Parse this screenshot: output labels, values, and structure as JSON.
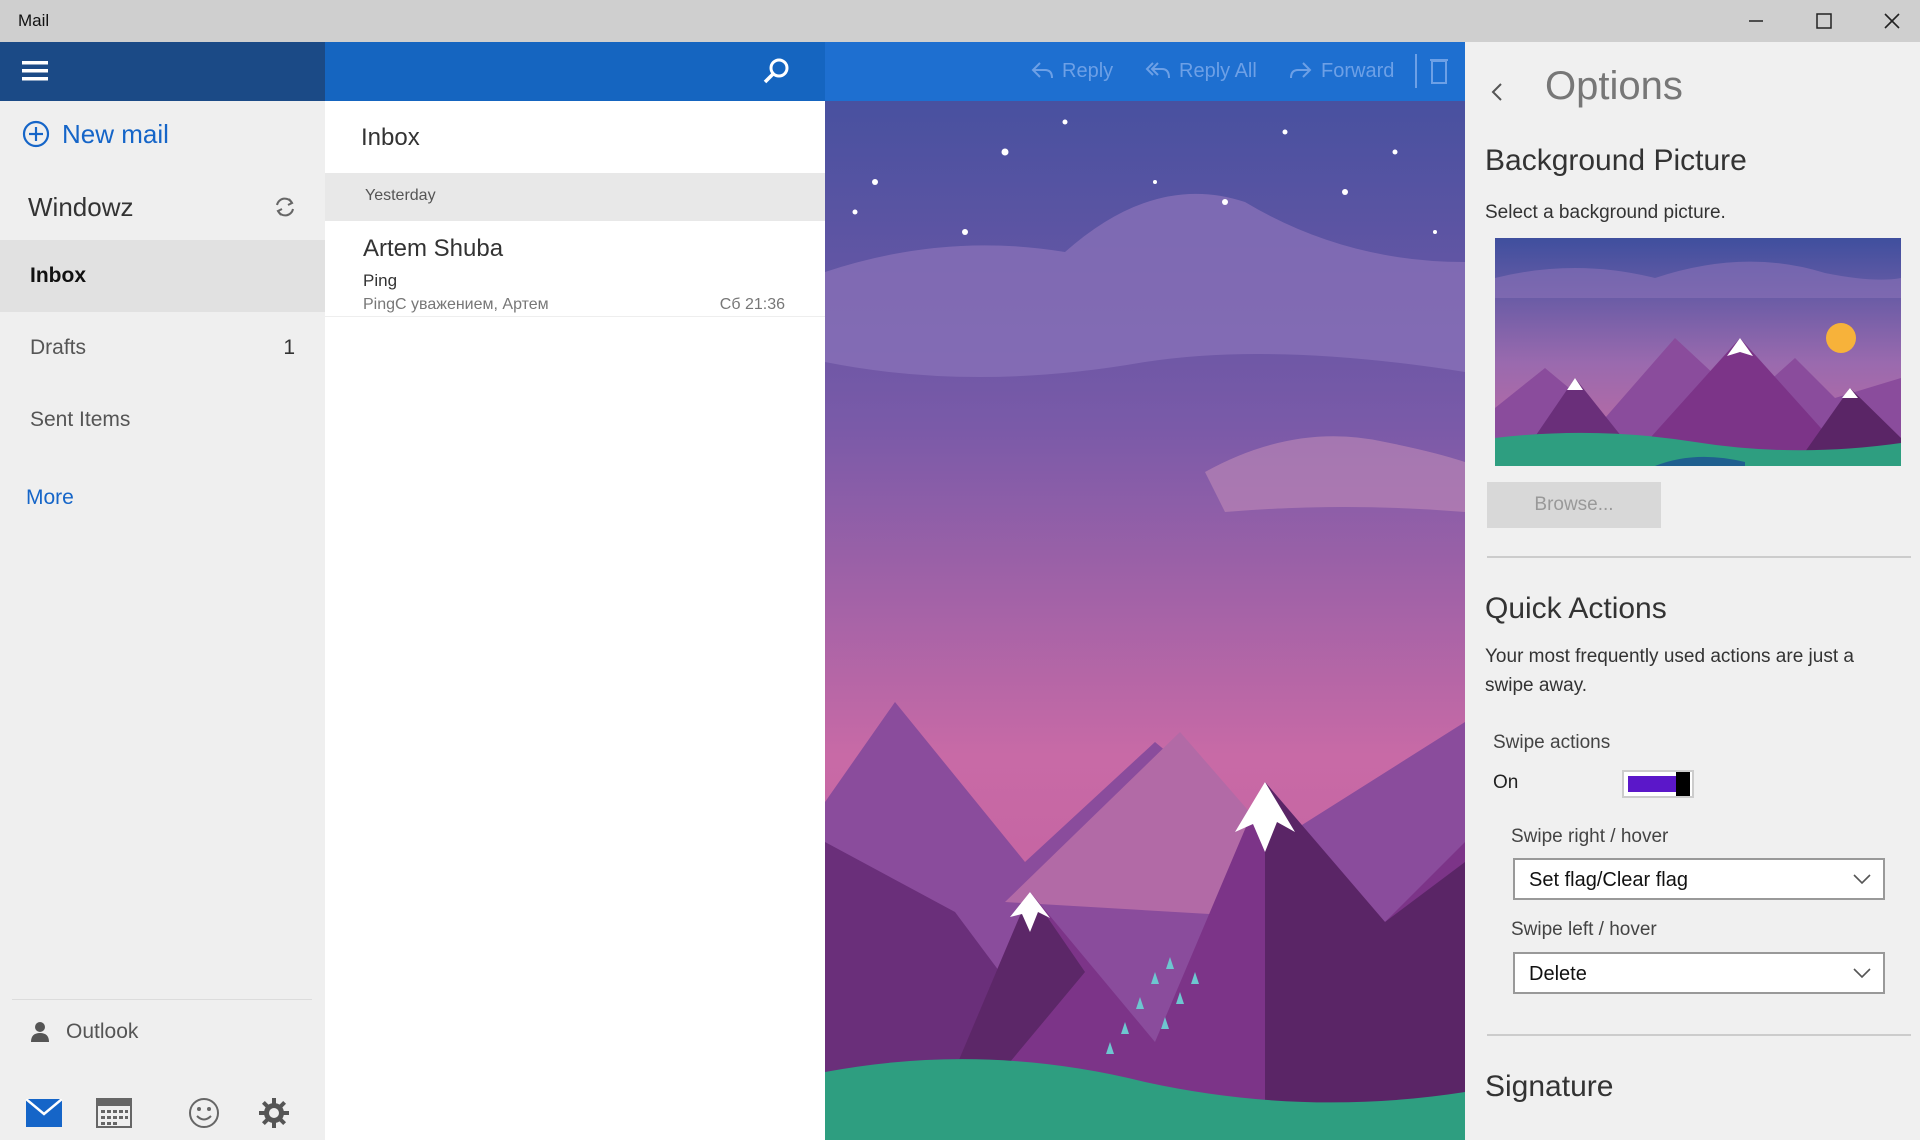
{
  "window": {
    "title": "Mail",
    "controls": [
      "minimize-icon",
      "maximize-icon",
      "close-icon"
    ]
  },
  "nav": {
    "new_mail": "New mail",
    "account_name": "Windowz",
    "folders": [
      {
        "label": "Inbox",
        "count": "",
        "selected": true
      },
      {
        "label": "Drafts",
        "count": "1",
        "selected": false
      },
      {
        "label": "Sent Items",
        "count": "",
        "selected": false
      }
    ],
    "more": "More",
    "account": "Outlook",
    "bottom_icons": [
      "mail-icon",
      "calendar-icon",
      "feedback-smiley-icon",
      "settings-gear-icon"
    ]
  },
  "message_list": {
    "title": "Inbox",
    "date_group": "Yesterday",
    "messages": [
      {
        "sender": "Artem Shuba",
        "subject": "Ping",
        "preview": "PingС уважением, Артем",
        "time": "Сб 21:36"
      }
    ]
  },
  "reading_pane": {
    "commands": [
      {
        "label": "Reply",
        "icon": "reply-icon"
      },
      {
        "label": "Reply All",
        "icon": "reply-all-icon"
      },
      {
        "label": "Forward",
        "icon": "forward-icon"
      }
    ],
    "background": "mountain night landscape"
  },
  "options": {
    "title": "Options",
    "background_picture": {
      "title": "Background Picture",
      "description": "Select a background picture.",
      "browse": "Browse..."
    },
    "quick_actions": {
      "title": "Quick Actions",
      "description": "Your most frequently used actions are just a swipe away.",
      "swipe_actions_label": "Swipe actions",
      "swipe_actions_state": "On",
      "swipe_right_label": "Swipe right / hover",
      "swipe_right_value": "Set flag/Clear flag",
      "swipe_left_label": "Swipe left / hover",
      "swipe_left_value": "Delete"
    },
    "signature": {
      "title": "Signature"
    }
  },
  "colors": {
    "nav_header": "#1b4a86",
    "list_header": "#1565c0",
    "command_bar": "#1e6fd0",
    "accent": "#1565c8",
    "toggle_fill": "#5b17c9"
  }
}
